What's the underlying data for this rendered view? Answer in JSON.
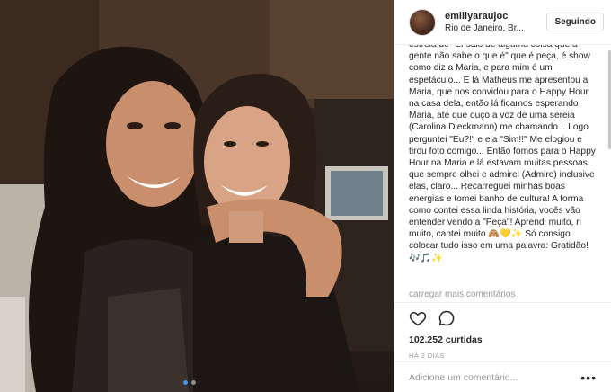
{
  "post": {
    "username": "emillyaraujoc",
    "location": "Rio de Janeiro, Br...",
    "follow_label": "Seguindo",
    "caption": "estreia de \"Ensaio de alguma coisa que a gente não sabe o que é\" que é peça, é show como diz a Maria, e para mim é um espetáculo... E lá Matheus me apresentou a Maria, que nos convidou para o Happy Hour na casa dela, então lá ficamos esperando Maria, até que ouço a voz de uma sereia (Carolina Dieckmann) me chamando... Logo perguntei \"Eu?!\" e ela \"Sim!!\" Me elogiou e tirou foto comigo... Então fomos para o Happy Hour na Maria e lá estavam muitas pessoas que sempre olhei e admirei (Admiro) inclusive elas, claro... Recarreguei minhas boas energias e tomei banho de cultura! A forma como contei essa linda história, vocês vão entender vendo a \"Peça\"! Aprendi muito, ri muito, cantei muito 🙈💛✨ Só consigo colocar tudo isso em uma palavra: Gratidão! 🎶🎵✨",
    "load_more_comments": "carregar mais comentários",
    "likes": "102.252 curtidas",
    "time_ago": "HÁ 2 DIAS",
    "comment_placeholder": "Adicione um comentário...",
    "options_label": "•••"
  },
  "icons": {
    "like": "heart-icon",
    "comment": "speech-bubble-icon"
  },
  "carousel": {
    "total": 2,
    "active": 1
  },
  "colors": {
    "accent": "#3897f0",
    "muted": "#999999",
    "text": "#262626"
  }
}
